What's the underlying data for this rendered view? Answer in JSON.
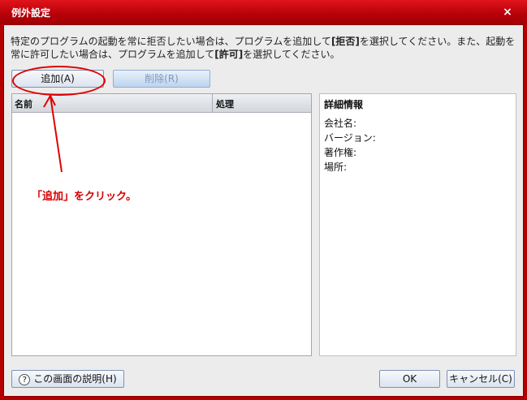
{
  "window": {
    "title": "例外設定",
    "close_glyph": "×"
  },
  "description": {
    "part1": "特定のプログラムの起動を常に拒否したい場合は、プログラムを追加して",
    "deny_label": "[拒否]",
    "part2": "を選択してください。また、起動を常に許可したい場合は、プログラムを追加して",
    "allow_label": "[許可]",
    "part3": "を選択してください。"
  },
  "toolbar": {
    "add_label": "追加(A)",
    "delete_label": "削除(R)"
  },
  "list": {
    "columns": [
      "名前",
      "処理"
    ],
    "rows": []
  },
  "details": {
    "title": "詳細情報",
    "rows": [
      "会社名:",
      "バージョン:",
      "著作権:",
      "場所:"
    ]
  },
  "footer": {
    "help_label": "この画面の説明(H)",
    "help_icon": "?",
    "ok_label": "OK",
    "cancel_label": "キャンセル(C)"
  },
  "annotation": {
    "text": "「追加」をクリック。"
  },
  "colors": {
    "title_bar": "#b60008",
    "annotation": "#e00000",
    "dialog_bg": "#ececec"
  }
}
